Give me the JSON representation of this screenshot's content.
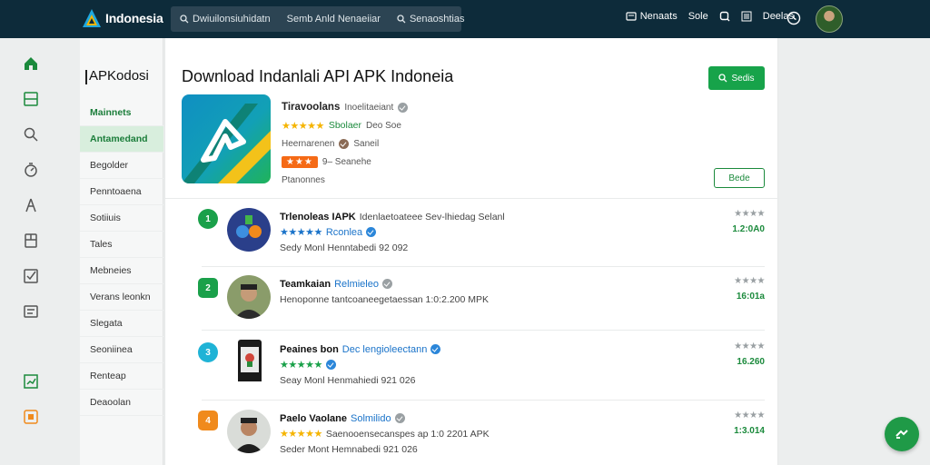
{
  "brand": {
    "name": "Indonesia"
  },
  "search": {
    "seg1": "Dwiuilonsiuhidatn",
    "seg2": "Semb Anld Nenaeiiar",
    "seg3": "Senaoshtias"
  },
  "topnav": {
    "item1": "Nenaats",
    "item2": "Sole",
    "item3": "Deelas"
  },
  "sidebar": {
    "title": "APKodosi",
    "items": [
      {
        "label": "Mainnets"
      },
      {
        "label": "Antamedand"
      },
      {
        "label": "Begolder"
      },
      {
        "label": "Penntoaena"
      },
      {
        "label": "Sotiiuis"
      },
      {
        "label": "Tales"
      },
      {
        "label": "Mebneies"
      },
      {
        "label": "Verans leonkn"
      },
      {
        "label": "Slegata"
      },
      {
        "label": "Seoniinea"
      },
      {
        "label": "Renteap"
      },
      {
        "label": "Deaoolan"
      }
    ]
  },
  "main": {
    "title": "Download Indanlali API APK Indoneia",
    "search_label": "Sedis",
    "bookmark_label": "Bede",
    "hero": {
      "name": "Tiravoolans",
      "name_sub": "Inoelitaeiant",
      "rating_text": "Sbolaer",
      "rating_extra": "Deo Soe",
      "developer": "Heernarenen",
      "developer_name": "Saneil",
      "badge_text": "9– Seanehe",
      "note": "Ptanonnes"
    },
    "list": [
      {
        "badge": "1",
        "title": "Trlenoleas IAPK",
        "title_rest": "Idenlaetoateee Sev-lhiedag Selanl",
        "sub": "Rconlea",
        "meta": "Sedy Monl Henntabedi 92 092",
        "value": "1.2:0A0"
      },
      {
        "badge": "2",
        "title": "Teamkaian",
        "title_rest": "Relmieleo",
        "sub": "",
        "meta": "Henoponne tantcoaneegetaessan 1:0:2.200 MPK",
        "value": "16:01a"
      },
      {
        "badge": "3",
        "title": "Peaines bon",
        "title_rest": "Dec lengioleectann",
        "sub": "",
        "meta": "Seay Monl Henmahiedi 921 026",
        "value": "16.260"
      },
      {
        "badge": "4",
        "title": "Paelo Vaolane",
        "title_rest": "Solmilido",
        "sub": "Saenooensecanspes ap 1:0 2201 APK",
        "meta": "Seder Mont Hemnabedi 921 026",
        "value": "1:3.014"
      }
    ]
  },
  "colors": {
    "accent": "#17a34a",
    "topbar": "#0d2b3a",
    "star": "#f5b400"
  },
  "icons": [
    "home-icon",
    "tablet-icon",
    "search-icon",
    "timer-icon",
    "run-icon",
    "store-icon",
    "checkbox-icon",
    "gallery-icon",
    "chart-icon",
    "orange-tag-icon",
    "clock-icon",
    "swap-icon"
  ]
}
